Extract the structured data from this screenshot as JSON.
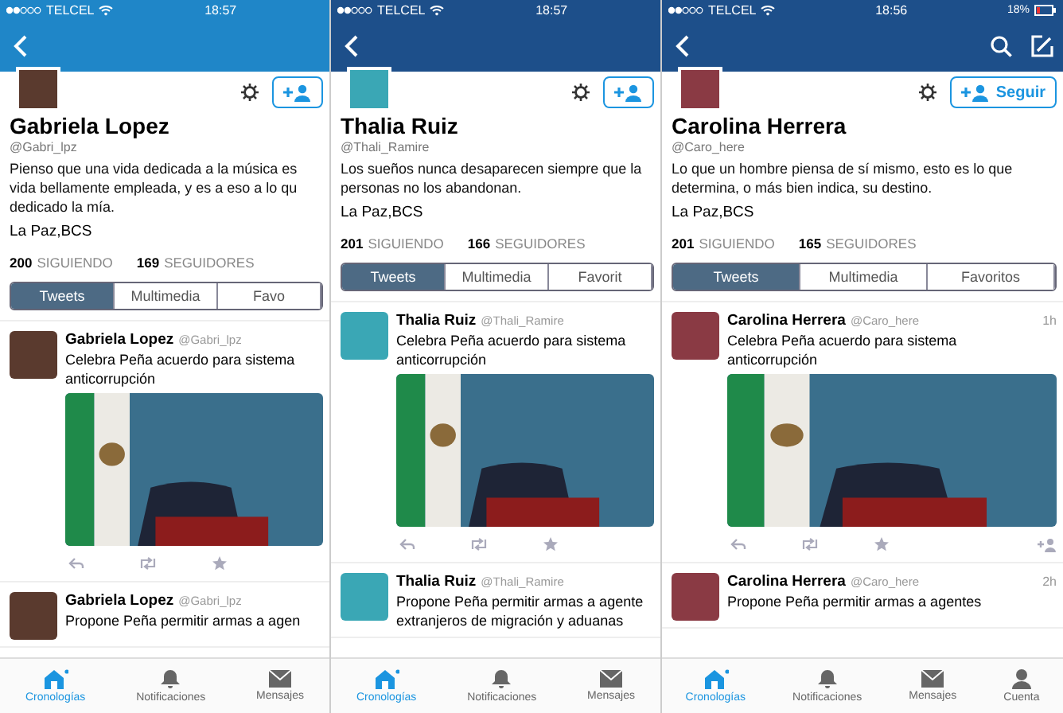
{
  "panels": [
    {
      "status": {
        "carrier": "TELCEL",
        "time": "18:57"
      },
      "profile": {
        "name": "Gabriela Lopez",
        "handle": "@Gabri_lpz",
        "bio_lines": [
          "Pienso que una vida dedicada a la música es",
          "vida bellamente empleada, y es a eso a lo qu",
          "dedicado la mía."
        ],
        "location": "La Paz,BCS",
        "following_count": "200",
        "following_label": "SIGUIENDO",
        "followers_count": "169",
        "followers_label": "SEGUIDORES"
      },
      "tabs": [
        {
          "label": "Tweets",
          "selected": true
        },
        {
          "label": "Multimedia",
          "selected": false
        },
        {
          "label": "Favo",
          "selected": false
        }
      ],
      "tweets": [
        {
          "kind": "photo",
          "name": "Gabriela Lopez",
          "handle": "@Gabri_lpz",
          "text_lines": [
            "Celebra Peña acuerdo para sistema",
            "anticorrupción"
          ],
          "actions": [
            {
              "kind": "reply"
            },
            {
              "kind": "retweet"
            },
            {
              "kind": "star"
            }
          ]
        },
        {
          "kind": "text",
          "name": "Gabriela Lopez",
          "handle": "@Gabri_lpz",
          "text_lines": [
            "Propone Peña permitir armas a agen"
          ]
        }
      ],
      "nav": [
        {
          "label": "Cronologías",
          "selected": true,
          "kind": "home"
        },
        {
          "label": "Notificaciones",
          "selected": false,
          "kind": "bell"
        },
        {
          "label": "Mensajes",
          "selected": false,
          "kind": "mail"
        }
      ]
    },
    {
      "status": {
        "carrier": "TELCEL",
        "time": "18:57"
      },
      "profile": {
        "name": "Thalia Ruiz",
        "handle": "@Thali_Ramire",
        "bio_lines": [
          "Los sueños nunca desaparecen siempre que la",
          "personas no los abandonan."
        ],
        "location": "La Paz,BCS",
        "following_count": "201",
        "following_label": "SIGUIENDO",
        "followers_count": "166",
        "followers_label": "SEGUIDORES"
      },
      "tabs": [
        {
          "label": "Tweets",
          "selected": true
        },
        {
          "label": "Multimedia",
          "selected": false
        },
        {
          "label": "Favorit",
          "selected": false
        }
      ],
      "tweets": [
        {
          "kind": "photo",
          "name": "Thalia Ruiz",
          "handle": "@Thali_Ramire",
          "text_lines": [
            "Celebra Peña acuerdo para sistema",
            "anticorrupción"
          ],
          "actions": [
            {
              "kind": "reply"
            },
            {
              "kind": "retweet"
            },
            {
              "kind": "star"
            }
          ]
        },
        {
          "kind": "text",
          "name": "Thalia Ruiz",
          "handle": "@Thali_Ramire",
          "text_lines": [
            "Propone Peña permitir armas a agente",
            "extranjeros de migración y aduanas"
          ]
        }
      ],
      "nav": [
        {
          "label": "Cronologías",
          "selected": true,
          "kind": "home"
        },
        {
          "label": "Notificaciones",
          "selected": false,
          "kind": "bell"
        },
        {
          "label": "Mensajes",
          "selected": false,
          "kind": "mail"
        }
      ]
    },
    {
      "status": {
        "carrier": "TELCEL",
        "time": "18:56",
        "battery": "18%"
      },
      "header": {
        "actions": [
          {
            "kind": "search"
          },
          {
            "kind": "compose"
          }
        ]
      },
      "profile": {
        "name": "Carolina Herrera",
        "handle": "@Caro_here",
        "bio_lines": [
          "Lo que un hombre piensa de sí mismo, esto es lo que",
          "determina, o más bien indica, su destino."
        ],
        "location": "La Paz,BCS",
        "following_count": "201",
        "following_label": "SIGUIENDO",
        "followers_count": "165",
        "followers_label": "SEGUIDORES",
        "follow_label": "Seguir"
      },
      "tabs": [
        {
          "label": "Tweets",
          "selected": true
        },
        {
          "label": "Multimedia",
          "selected": false
        },
        {
          "label": "Favoritos",
          "selected": false
        }
      ],
      "tweets": [
        {
          "kind": "photo",
          "name": "Carolina Herrera",
          "handle": "@Caro_here",
          "time": "1h",
          "text_lines": [
            "Celebra Peña acuerdo para sistema",
            "anticorrupción"
          ],
          "actions": [
            {
              "kind": "reply"
            },
            {
              "kind": "retweet"
            },
            {
              "kind": "star"
            },
            {
              "kind": "follow"
            }
          ]
        },
        {
          "kind": "text",
          "name": "Carolina Herrera",
          "handle": "@Caro_here",
          "time": "2h",
          "text_lines": [
            "Propone Peña permitir armas a agentes"
          ]
        }
      ],
      "nav": [
        {
          "label": "Cronologías",
          "selected": true,
          "kind": "home"
        },
        {
          "label": "Notificaciones",
          "selected": false,
          "kind": "bell"
        },
        {
          "label": "Mensajes",
          "selected": false,
          "kind": "mail"
        },
        {
          "label": "Cuenta",
          "selected": false,
          "kind": "person"
        }
      ]
    }
  ]
}
